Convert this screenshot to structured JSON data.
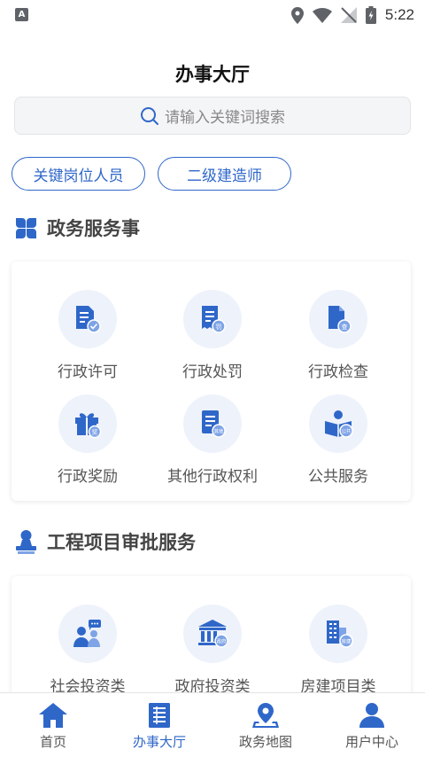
{
  "status_bar": {
    "time": "5:22",
    "app_icon": "A",
    "icons": [
      "location-icon",
      "wifi-icon",
      "no-signal-icon",
      "battery-icon"
    ]
  },
  "header": {
    "title": "办事大厅"
  },
  "search": {
    "placeholder": "请输入关键词搜索"
  },
  "chips": [
    "关键岗位人员",
    "二级建造师"
  ],
  "section_1": {
    "title": "政务服务事",
    "items": [
      {
        "label": "行政许可",
        "icon": "permit-icon"
      },
      {
        "label": "行政处罚",
        "icon": "penalty-icon"
      },
      {
        "label": "行政检查",
        "icon": "inspection-icon"
      },
      {
        "label": "行政奖励",
        "icon": "reward-icon"
      },
      {
        "label": "其他行政权利",
        "icon": "other-rights-icon"
      },
      {
        "label": "公共服务",
        "icon": "public-service-icon"
      }
    ]
  },
  "section_2": {
    "title": "工程项目审批服务",
    "items": [
      {
        "label": "社会投资类",
        "icon": "social-investment-icon"
      },
      {
        "label": "政府投资类",
        "icon": "government-investment-icon"
      },
      {
        "label": "房建项目类",
        "icon": "building-project-icon"
      }
    ]
  },
  "bottom_nav": [
    {
      "label": "首页",
      "icon": "home-icon"
    },
    {
      "label": "办事大厅",
      "icon": "hall-icon",
      "active": true
    },
    {
      "label": "政务地图",
      "icon": "map-icon"
    },
    {
      "label": "用户中心",
      "icon": "user-icon"
    }
  ],
  "colors": {
    "accent": "#2f67c9",
    "icon_bg": "#eef2fb"
  }
}
